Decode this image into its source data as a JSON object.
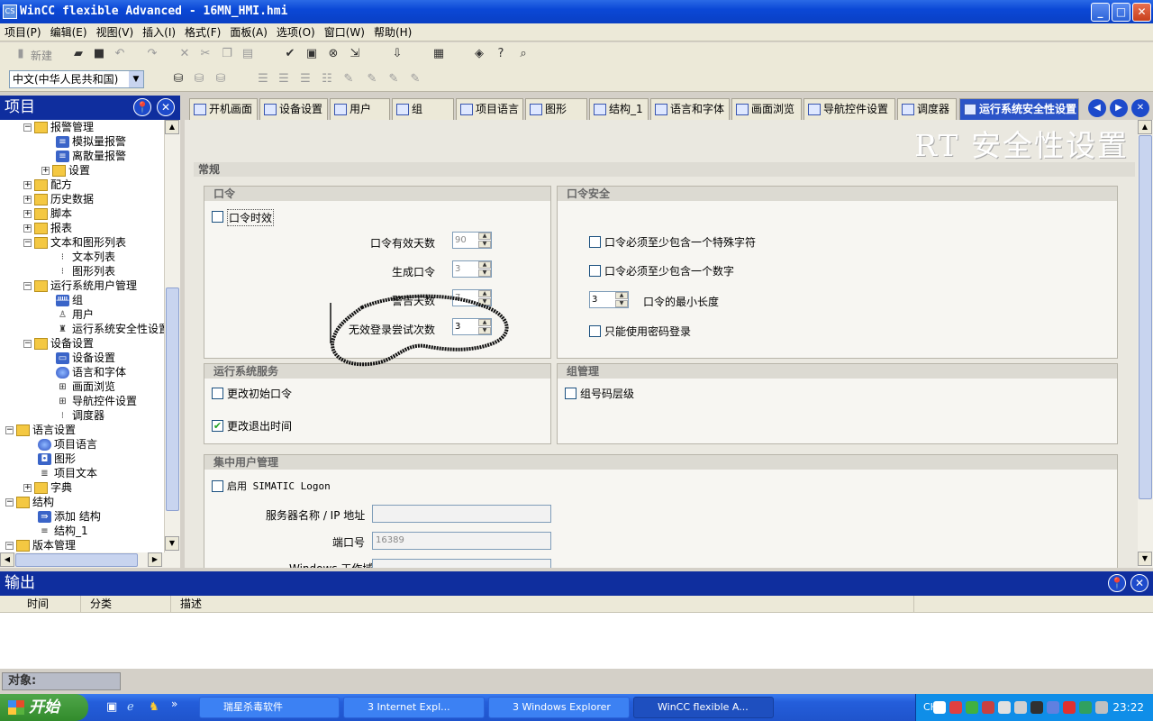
{
  "window": {
    "title": "WinCC flexible Advanced - 16MN_HMI.hmi",
    "app_icon": "CS",
    "minimize": "_",
    "maximize": "□",
    "close": "✕"
  },
  "menu": [
    "项目(P)",
    "编辑(E)",
    "视图(V)",
    "插入(I)",
    "格式(F)",
    "面板(A)",
    "选项(O)",
    "窗口(W)",
    "帮助(H)"
  ],
  "toolbar": {
    "new_label": "新建",
    "language": "中文(中华人民共和国)"
  },
  "project_panel": {
    "title": "项目"
  },
  "tree": [
    {
      "label": "报警管理",
      "icon": "folder-icon"
    },
    {
      "label": "模拟量报警",
      "icon": "analog-alarm-icon"
    },
    {
      "label": "离散量报警",
      "icon": "discrete-alarm-icon"
    },
    {
      "label": "设置",
      "icon": "settings-folder-icon"
    },
    {
      "label": "配方",
      "icon": "folder-icon"
    },
    {
      "label": "历史数据",
      "icon": "folder-icon"
    },
    {
      "label": "脚本",
      "icon": "folder-icon"
    },
    {
      "label": "报表",
      "icon": "folder-icon"
    },
    {
      "label": "文本和图形列表",
      "icon": "folder-icon"
    },
    {
      "label": "文本列表",
      "icon": "text-list-icon"
    },
    {
      "label": "图形列表",
      "icon": "graphic-list-icon"
    },
    {
      "label": "运行系统用户管理",
      "icon": "folder-icon"
    },
    {
      "label": "组",
      "icon": "group-icon"
    },
    {
      "label": "用户",
      "icon": "user-icon"
    },
    {
      "label": "运行系统安全性设置",
      "icon": "security-icon"
    },
    {
      "label": "设备设置",
      "icon": "folder-icon"
    },
    {
      "label": "设备设置",
      "icon": "device-icon"
    },
    {
      "label": "语言和字体",
      "icon": "globe-icon"
    },
    {
      "label": "画面浏览",
      "icon": "screen-nav-icon"
    },
    {
      "label": "导航控件设置",
      "icon": "nav-control-icon"
    },
    {
      "label": "调度器",
      "icon": "scheduler-icon"
    },
    {
      "label": "语言设置",
      "icon": "folder-icon"
    },
    {
      "label": "项目语言",
      "icon": "globe-icon"
    },
    {
      "label": "图形",
      "icon": "graphics-icon"
    },
    {
      "label": "项目文本",
      "icon": "text-icon"
    },
    {
      "label": "字典",
      "icon": "folder-icon"
    },
    {
      "label": "结构",
      "icon": "folder-icon"
    },
    {
      "label": "添加 结构",
      "icon": "add-structure-icon"
    },
    {
      "label": "结构_1",
      "icon": "structure-icon"
    },
    {
      "label": "版本管理",
      "icon": "folder-icon"
    }
  ],
  "tabs": [
    "开机画面",
    "设备设置",
    "用户",
    "组",
    "项目语言",
    "图形",
    "结构_1",
    "语言和字体",
    "画面浏览",
    "导航控件设置",
    "调度器",
    "运行系统安全性设置"
  ],
  "editor": {
    "title": "RT 安全性设置",
    "section_general": "常规",
    "password": {
      "title": "口令",
      "aging_label": "口令时效",
      "aging_checked": false,
      "valid_days_label": "口令有效天数",
      "valid_days": "90",
      "generations_label": "生成口令",
      "generations": "3",
      "warn_days_label": "警告天数",
      "warn_days": "7",
      "invalid_logon_label": "无效登录尝试次数",
      "invalid_logon": "3"
    },
    "password_security": {
      "title": "口令安全",
      "special_char_label": "口令必须至少包含一个特殊字符",
      "digit_label": "口令必须至少包含一个数字",
      "min_length": "3",
      "min_length_label": "口令的最小长度",
      "password_only_label": "只能使用密码登录"
    },
    "runtime_services": {
      "title": "运行系统服务",
      "change_initial_label": "更改初始口令",
      "change_initial_checked": false,
      "change_logoff_label": "更改退出时间",
      "change_logoff_checked": true
    },
    "group_mgmt": {
      "title": "组管理",
      "group_number_label": "组号码层级"
    },
    "central_user": {
      "title": "集中用户管理",
      "enable_label": "启用 SIMATIC Logon",
      "server_label": "服务器名称 / IP 地址",
      "server_value": "",
      "port_label": "端口号",
      "port_value": "16389",
      "workgroup_label": "Windows 工作域"
    }
  },
  "output": {
    "title": "输出",
    "columns": [
      "时间",
      "分类",
      "描述"
    ]
  },
  "object_bar": {
    "label": "对象:"
  },
  "taskbar": {
    "start": "开始",
    "tasks": [
      "瑞星杀毒软件",
      "3 Internet Expl...",
      "3 Windows Explorer",
      "WinCC flexible A..."
    ],
    "tray_lang": "CH",
    "clock": "23:22"
  }
}
